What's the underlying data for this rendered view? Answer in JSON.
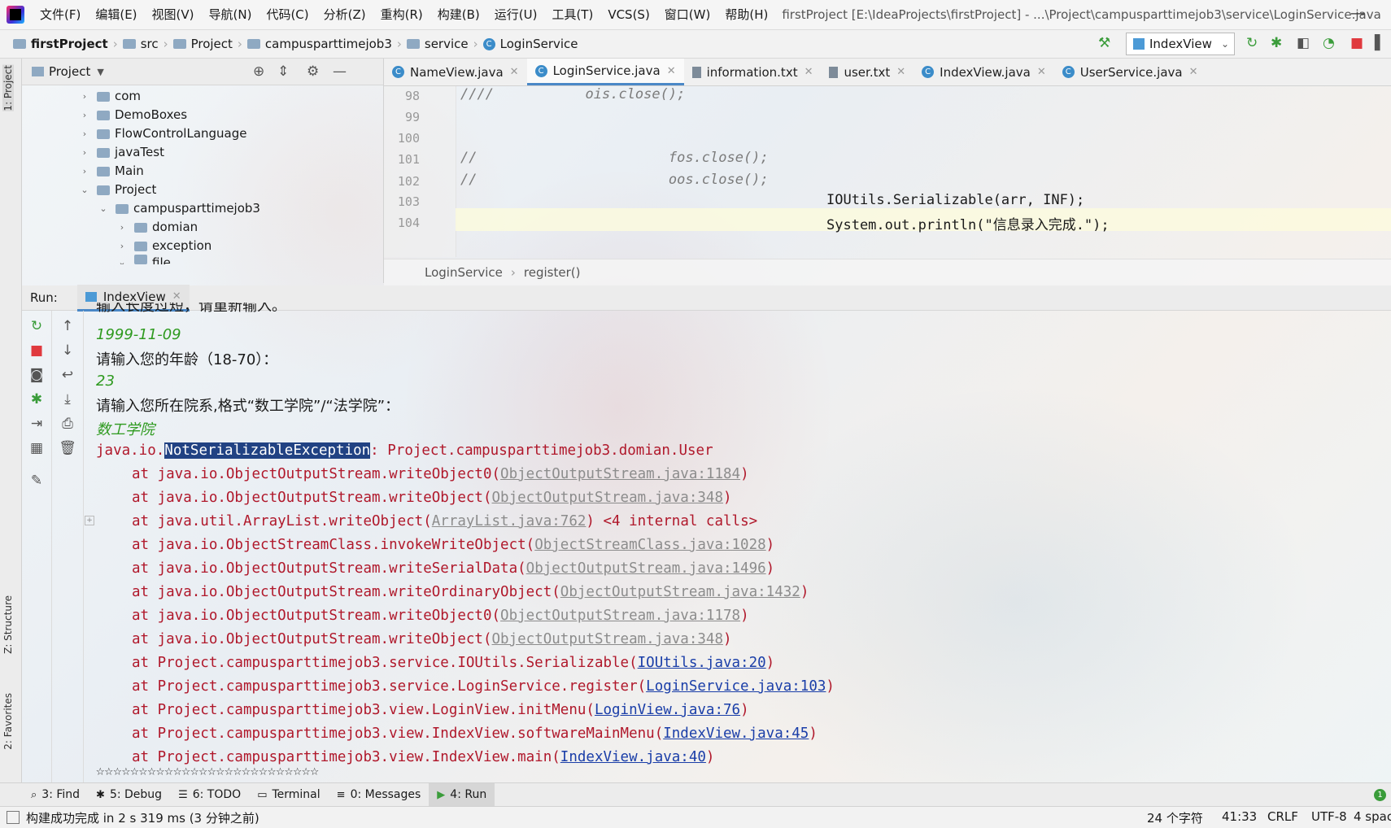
{
  "window": {
    "title": "firstProject [E:\\IdeaProjects\\firstProject] - ...\\Project\\campusparttimejob3\\service\\LoginService.java",
    "minimize": "—"
  },
  "menu": [
    "文件(F)",
    "编辑(E)",
    "视图(V)",
    "导航(N)",
    "代码(C)",
    "分析(Z)",
    "重构(R)",
    "构建(B)",
    "运行(U)",
    "工具(T)",
    "VCS(S)",
    "窗口(W)",
    "帮助(H)"
  ],
  "breadcrumb": [
    "firstProject",
    "src",
    "Project",
    "campusparttimejob3",
    "service",
    "LoginService"
  ],
  "run_config": "IndexView",
  "project_panel": {
    "title": "Project",
    "tree": [
      {
        "label": "com",
        "depth": 0,
        "expanded": false
      },
      {
        "label": "DemoBoxes",
        "depth": 0,
        "expanded": false
      },
      {
        "label": "FlowControlLanguage",
        "depth": 0,
        "expanded": false
      },
      {
        "label": "javaTest",
        "depth": 0,
        "expanded": false
      },
      {
        "label": "Main",
        "depth": 0,
        "expanded": false
      },
      {
        "label": "Project",
        "depth": 0,
        "expanded": true
      },
      {
        "label": "campusparttimejob3",
        "depth": 1,
        "expanded": true
      },
      {
        "label": "domian",
        "depth": 2,
        "expanded": false
      },
      {
        "label": "exception",
        "depth": 2,
        "expanded": false
      },
      {
        "label": "file",
        "depth": 2,
        "expanded": true
      }
    ]
  },
  "editor_tabs": [
    {
      "label": "NameView.java",
      "kind": "class",
      "active": false
    },
    {
      "label": "LoginService.java",
      "kind": "class",
      "active": true
    },
    {
      "label": "information.txt",
      "kind": "text",
      "active": false
    },
    {
      "label": "user.txt",
      "kind": "text",
      "active": false
    },
    {
      "label": "IndexView.java",
      "kind": "class",
      "active": false
    },
    {
      "label": "UserService.java",
      "kind": "class",
      "active": false
    }
  ],
  "code_lines": [
    {
      "num": "98",
      "text": "////           ois.close();",
      "comment": true
    },
    {
      "num": "99",
      "text": "",
      "comment": false
    },
    {
      "num": "100",
      "text": "",
      "comment": false
    },
    {
      "num": "101",
      "text": "//                       fos.close();",
      "comment": true
    },
    {
      "num": "102",
      "text": "//                       oos.close();",
      "comment": true
    },
    {
      "num": "103",
      "text": "IOUtils.Serializable(arr, INF);",
      "comment": false
    },
    {
      "num": "104",
      "text": "System.out.println(\"信息录入完成.\");",
      "comment": false
    }
  ],
  "editor_breadcrumb": [
    "LoginService",
    "register()"
  ],
  "run": {
    "label": "Run:",
    "tab": "IndexView",
    "console": {
      "line0": "输入长度过短，请重新输入。",
      "input1": "1999-11-09",
      "prompt2": "请输入您的年龄（18-70）：",
      "input2": "23",
      "prompt3": "请输入您所在院系,格式“数工学院”/“法学院”：",
      "input3": "数工学院",
      "exc_prefix": "java.io.",
      "exc_name": "NotSerializableException",
      "exc_suffix": ": Project.campusparttimejob3.domian.User",
      "stack": [
        {
          "call": "at java.io.ObjectOutputStream.writeObject0(",
          "link": "ObjectOutputStream.java:1184",
          "tail": ")",
          "jdk": true
        },
        {
          "call": "at java.io.ObjectOutputStream.writeObject(",
          "link": "ObjectOutputStream.java:348",
          "tail": ")",
          "jdk": true
        },
        {
          "call": "at java.util.ArrayList.writeObject(",
          "link": "ArrayList.java:762",
          "tail": ") <4 internal calls>",
          "jdk": true
        },
        {
          "call": "at java.io.ObjectStreamClass.invokeWriteObject(",
          "link": "ObjectStreamClass.java:1028",
          "tail": ")",
          "jdk": true
        },
        {
          "call": "at java.io.ObjectOutputStream.writeSerialData(",
          "link": "ObjectOutputStream.java:1496",
          "tail": ")",
          "jdk": true
        },
        {
          "call": "at java.io.ObjectOutputStream.writeOrdinaryObject(",
          "link": "ObjectOutputStream.java:1432",
          "tail": ")",
          "jdk": true
        },
        {
          "call": "at java.io.ObjectOutputStream.writeObject0(",
          "link": "ObjectOutputStream.java:1178",
          "tail": ")",
          "jdk": true
        },
        {
          "call": "at java.io.ObjectOutputStream.writeObject(",
          "link": "ObjectOutputStream.java:348",
          "tail": ")",
          "jdk": true
        },
        {
          "call": "at Project.campusparttimejob3.service.IOUtils.Serializable(",
          "link": "IOUtils.java:20",
          "tail": ")",
          "jdk": false
        },
        {
          "call": "at Project.campusparttimejob3.service.LoginService.register(",
          "link": "LoginService.java:103",
          "tail": ")",
          "jdk": false
        },
        {
          "call": "at Project.campusparttimejob3.view.LoginView.initMenu(",
          "link": "LoginView.java:76",
          "tail": ")",
          "jdk": false
        },
        {
          "call": "at Project.campusparttimejob3.view.IndexView.softwareMainMenu(",
          "link": "IndexView.java:45",
          "tail": ")",
          "jdk": false
        },
        {
          "call": "at Project.campusparttimejob3.view.IndexView.main(",
          "link": "IndexView.java:40",
          "tail": ")",
          "jdk": false
        }
      ],
      "stars": "☆☆☆☆☆☆☆☆☆☆☆☆☆☆☆☆☆☆☆☆☆☆☆☆☆☆"
    }
  },
  "side_tabs": {
    "project": "1: Project",
    "structure": "Z: Structure",
    "favorites": "2: Favorites"
  },
  "bottom_tools": [
    {
      "label": "3: Find",
      "icon": "search-icon"
    },
    {
      "label": "5: Debug",
      "icon": "bug-icon"
    },
    {
      "label": "6: TODO",
      "icon": "list-icon"
    },
    {
      "label": "Terminal",
      "icon": "terminal-icon"
    },
    {
      "label": "0: Messages",
      "icon": "messages-icon"
    },
    {
      "label": "4: Run",
      "icon": "run-icon"
    }
  ],
  "event_log_badge": "1",
  "status": {
    "message": "构建成功完成 in 2 s 319 ms (3 分钟之前)",
    "chars": "24 个字符",
    "position": "41:33",
    "line_sep": "CRLF",
    "encoding": "UTF-8",
    "indent": "4 spac"
  },
  "colors": {
    "accent": "#4a88c7",
    "error_text": "#b0182b",
    "input_text": "#2e9a1f",
    "link": "#1a3ea8",
    "selection": "#214283",
    "stop_red": "#e0393e",
    "run_green": "#3a9c3a"
  }
}
